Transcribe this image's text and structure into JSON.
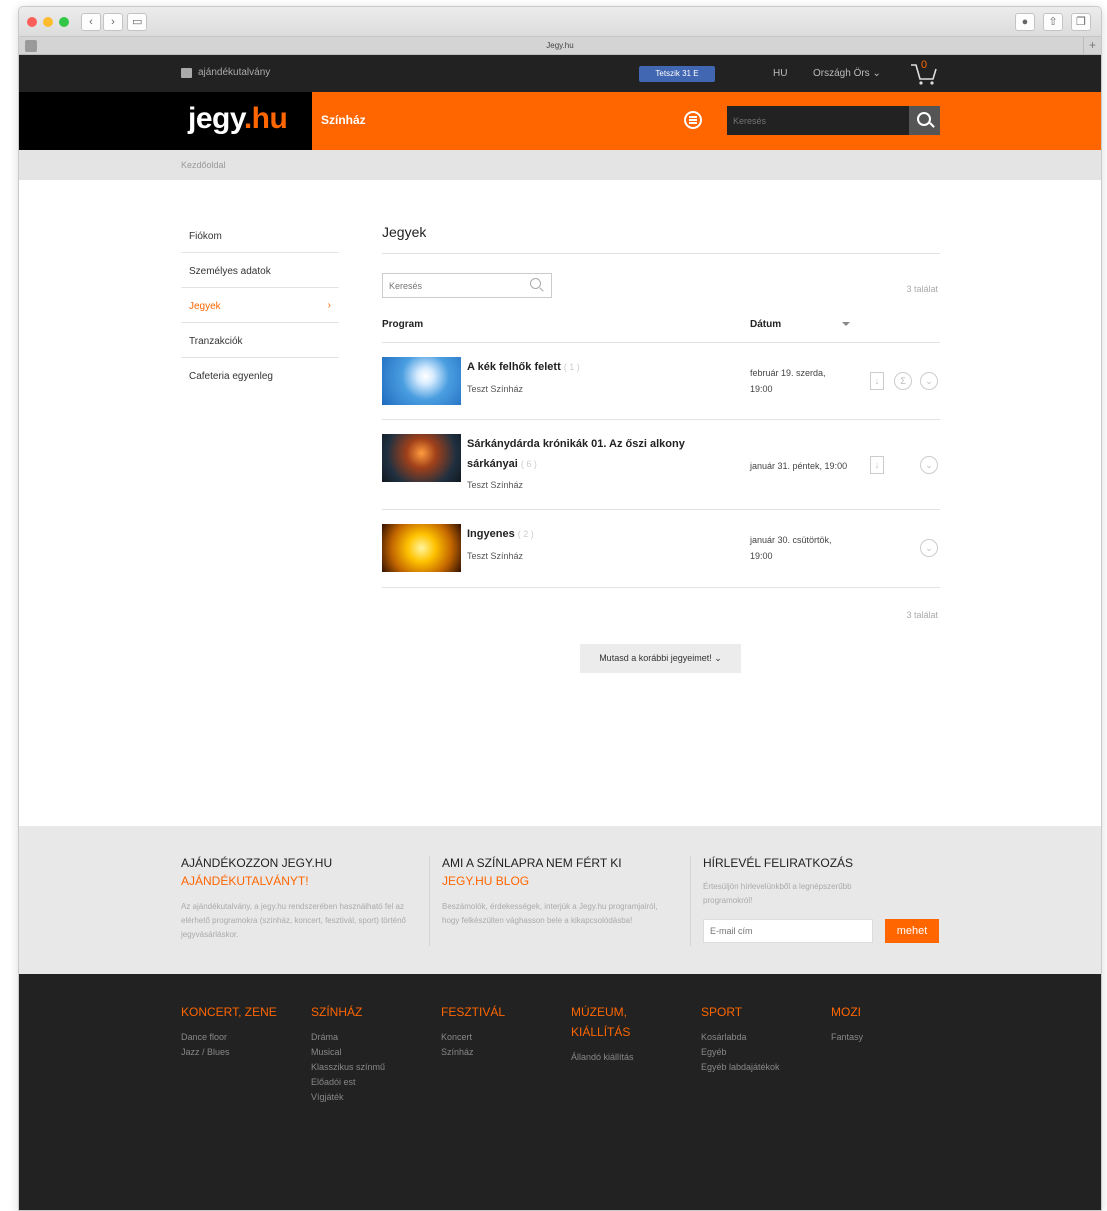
{
  "browser": {
    "tab_title": "Jegy.hu",
    "back": "‹",
    "forward": "›"
  },
  "topbar": {
    "gift_label": "ajándékutalvány",
    "fb_label": "Tetszik 31 E",
    "lang": "HU",
    "user": "Országh Örs ⌄",
    "cart_count": "0"
  },
  "header": {
    "logo_main": "jegy",
    "logo_suffix": ".hu",
    "section": "Színház",
    "search_placeholder": "Keresés"
  },
  "breadcrumb": "Kezdőoldal",
  "sidebar": {
    "items": [
      {
        "label": "Fiókom"
      },
      {
        "label": "Személyes adatok"
      },
      {
        "label": "Jegyek",
        "chevron": "›"
      },
      {
        "label": "Tranzakciók"
      },
      {
        "label": "Cafeteria egyenleg"
      }
    ]
  },
  "tickets": {
    "title": "Jegyek",
    "search_placeholder": "Keresés",
    "count": "3 találat",
    "col_program": "Program",
    "col_date": "Dátum",
    "rows": [
      {
        "title": "A kék felhők felett",
        "qty": "( 1 )",
        "venue": "Teszt Színház",
        "date_line1": "február 19. szerda,",
        "date_line2": "19:00"
      },
      {
        "title_line1": "Sárkánydárda krónikák 01. Az őszi alkony",
        "title_line2": "sárkányai",
        "qty": "( 6 )",
        "venue": "Teszt Színház",
        "date_line1": "január 31. péntek, 19:00"
      },
      {
        "title": "Ingyenes",
        "qty": "( 2 )",
        "venue": "Teszt Színház",
        "date_line1": "január 30. csütörtök,",
        "date_line2": "19:00"
      }
    ],
    "count_bottom": "3 találat",
    "more_button": "Mutasd a korábbi jegyeimet! ⌄"
  },
  "footer": {
    "col1_title": "AJÁNDÉKOZZON JEGY.HU",
    "col1_subtitle": "AJÁNDÉKUTALVÁNYT!",
    "col1_text": "Az ajándékutalvány, a jegy.hu rendszerében használható fel az elérhető programokra (színház, koncert, fesztivál, sport) történő jegyvásárláskor.",
    "col2_title": "AMI A SZÍNLAPRA NEM FÉRT KI",
    "col2_subtitle": "JEGY.HU BLOG",
    "col2_text": "Beszámolók, érdekességek, interjúk a Jegy.hu programjairól, hogy felkészülten vághasson bele a kikapcsolódásba!",
    "col3_title": "HÍRLEVÉL FELIRATKOZÁS",
    "col3_text": "Értesüljön hírlevelünkből a legnépszerűbb programokról!",
    "email_placeholder": "E-mail cím",
    "submit": "mehet"
  },
  "categories": [
    {
      "title": "KONCERT, ZENE",
      "items": [
        "Dance floor",
        "Jazz / Blues"
      ]
    },
    {
      "title": "SZÍNHÁZ",
      "items": [
        "Dráma",
        "Musical",
        "Klasszikus színmű",
        "Előadói est",
        "Vígjáték"
      ]
    },
    {
      "title": "FESZTIVÁL",
      "items": [
        "Koncert",
        "Színház"
      ]
    },
    {
      "title": "MÚZEUM, KIÁLLÍTÁS",
      "items": [
        "Állandó kiállítás"
      ]
    },
    {
      "title": "SPORT",
      "items": [
        "Kosárlabda",
        "Egyéb",
        "Egyéb labdajátékok"
      ]
    },
    {
      "title": "MOZI",
      "items": [
        "Fantasy"
      ]
    }
  ]
}
